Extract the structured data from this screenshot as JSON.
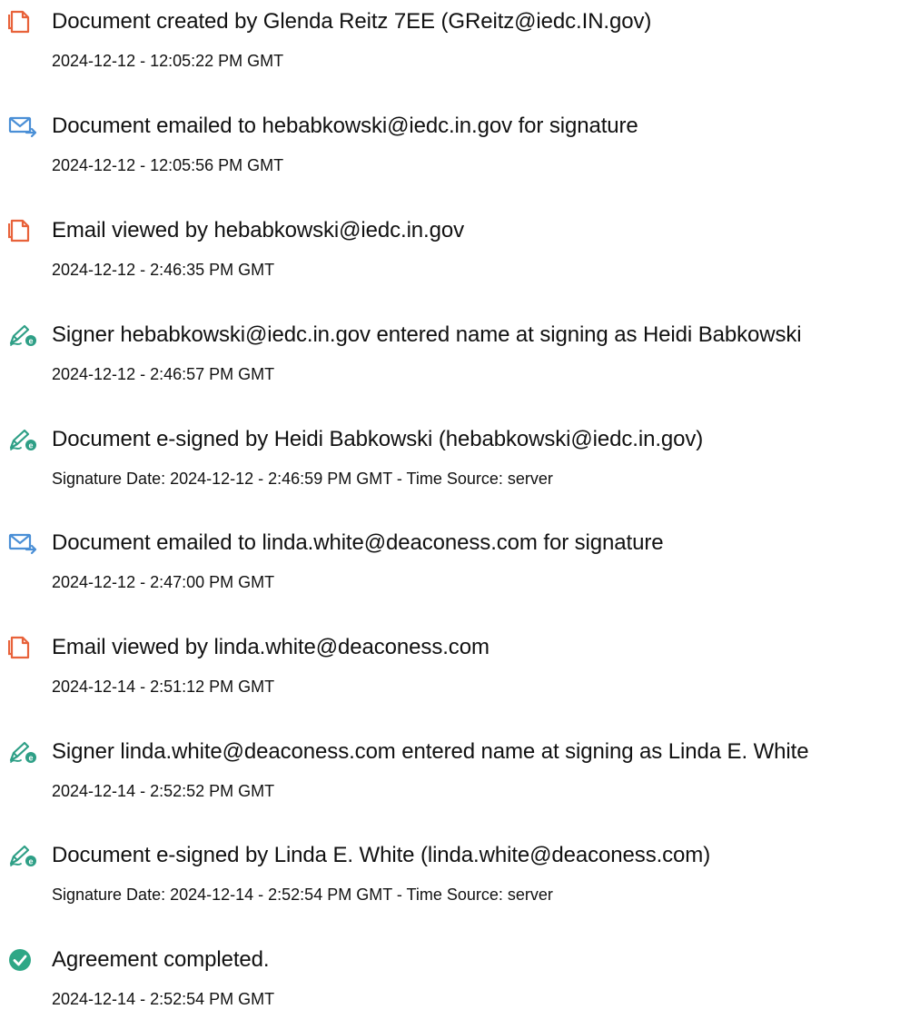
{
  "colors": {
    "document_icon": "#e8623a",
    "email_icon": "#4a8fd6",
    "signature_icon": "#2e9f86",
    "check_icon": "#2ea786",
    "text": "#111111"
  },
  "events": [
    {
      "icon": "document-icon",
      "text": "Document created by Glenda Reitz 7EE (GReitz@iedc.IN.gov)",
      "timestamp": "2024-12-12 - 12:05:22 PM GMT"
    },
    {
      "icon": "email-sent-icon",
      "text": "Document emailed to hebabkowski@iedc.in.gov for signature",
      "timestamp": "2024-12-12 - 12:05:56 PM GMT"
    },
    {
      "icon": "document-icon",
      "text": "Email viewed by hebabkowski@iedc.in.gov",
      "timestamp": "2024-12-12 - 2:46:35 PM GMT"
    },
    {
      "icon": "signature-icon",
      "text": "Signer hebabkowski@iedc.in.gov entered name at signing as Heidi Babkowski",
      "timestamp": "2024-12-12 - 2:46:57 PM GMT"
    },
    {
      "icon": "signature-icon",
      "text": "Document e-signed by Heidi Babkowski (hebabkowski@iedc.in.gov)",
      "timestamp": "Signature Date: 2024-12-12 - 2:46:59 PM GMT - Time Source: server"
    },
    {
      "icon": "email-sent-icon",
      "text": "Document emailed to linda.white@deaconess.com for signature",
      "timestamp": "2024-12-12 - 2:47:00 PM GMT"
    },
    {
      "icon": "document-icon",
      "text": "Email viewed by linda.white@deaconess.com",
      "timestamp": "2024-12-14 - 2:51:12 PM GMT"
    },
    {
      "icon": "signature-icon",
      "text": "Signer linda.white@deaconess.com entered name at signing as Linda E. White",
      "timestamp": "2024-12-14 - 2:52:52 PM GMT"
    },
    {
      "icon": "signature-icon",
      "text": "Document e-signed by Linda E. White (linda.white@deaconess.com)",
      "timestamp": "Signature Date: 2024-12-14 - 2:52:54 PM GMT - Time Source: server"
    },
    {
      "icon": "check-circle-icon",
      "text": "Agreement completed.",
      "timestamp": "2024-12-14 - 2:52:54 PM GMT"
    }
  ]
}
